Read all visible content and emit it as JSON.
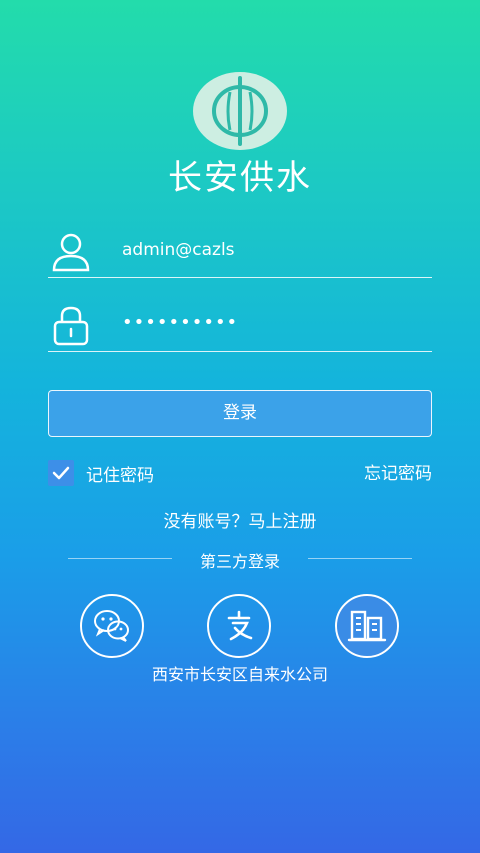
{
  "app": {
    "title": "长安供水",
    "company": "西安市长安区自来水公司"
  },
  "login": {
    "username_value": "admin@cazls",
    "password_value": "••••••••••",
    "login_button": "登录",
    "remember_label": "记住密码",
    "remember_checked": true,
    "forgot_link": "忘记密码",
    "register_link": "没有账号？马上注册"
  },
  "third_party": {
    "title": "第三方登录",
    "providers": [
      {
        "name": "wechat",
        "icon": "wechat-icon"
      },
      {
        "name": "alipay",
        "icon": "alipay-icon"
      },
      {
        "name": "enterprise",
        "icon": "building-icon"
      }
    ]
  },
  "colors": {
    "accent": "#3ba2e9",
    "checkbox": "#3d8fe8",
    "logo_bg": "#cdeee2",
    "logo_mark": "#2fb9a8"
  }
}
